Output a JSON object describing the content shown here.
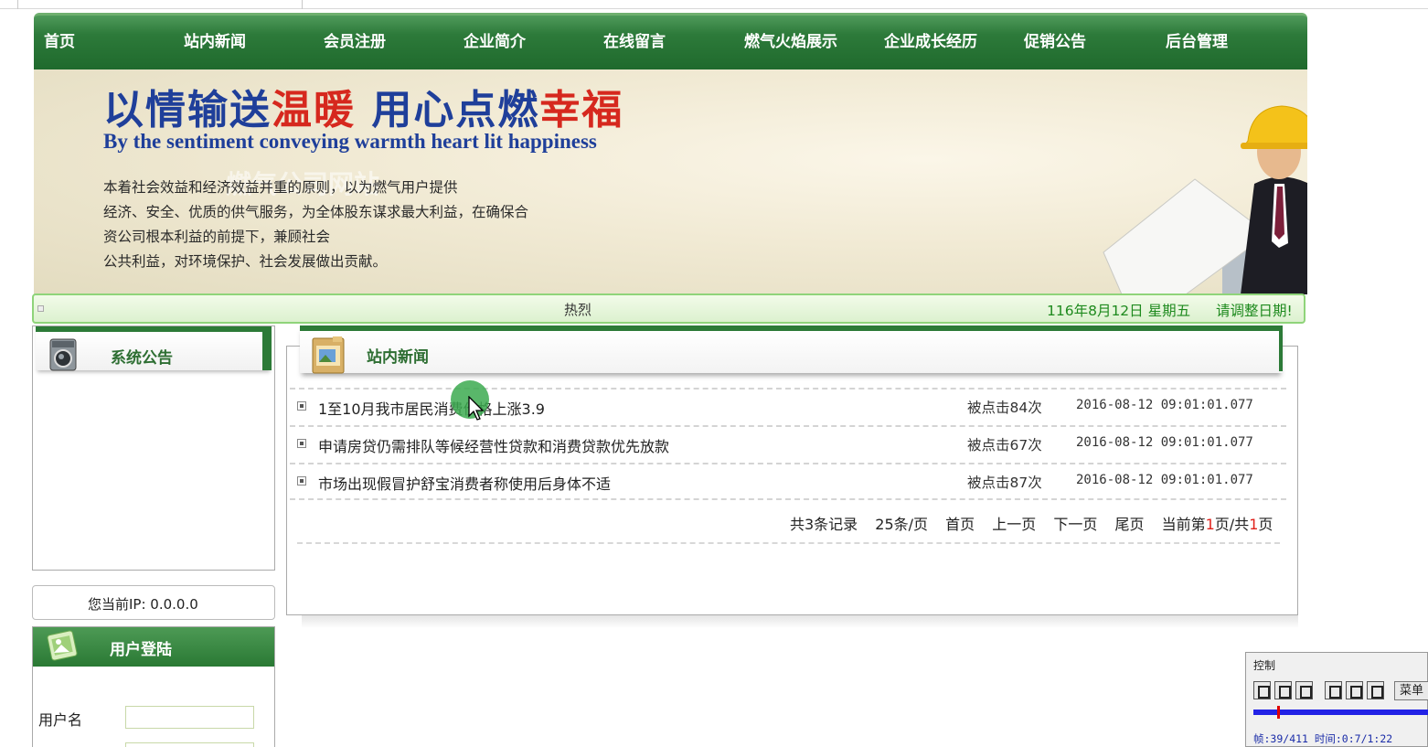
{
  "nav": {
    "items": [
      "首页",
      "站内新闻",
      "会员注册",
      "企业简介",
      "在线留言",
      "燃气火焰展示",
      "企业成长经历",
      "促销公告",
      "后台管理"
    ]
  },
  "banner": {
    "slogan_part1": "以情输送",
    "slogan_part2": "温暖",
    "slogan_part3": " 用心点燃",
    "slogan_part4": "幸福",
    "slogan_en": "By the sentiment conveying warmth heart lit happiness",
    "ghost_title": "燃气公司网站",
    "desc_lines": [
      "本着社会效益和经济效益并重的原则，以为燃气用户提供",
      "经济、安全、优质的供气服务，为全体股东谋求最大利益，在确保合",
      "资公司根本利益的前提下，兼顾社会",
      "公共利益，对环境保护、社会发展做出贡献。"
    ]
  },
  "infobar": {
    "marquee": "热烈",
    "date": "116年8月12日 星期五",
    "adjust": "请调整日期!"
  },
  "sidebar": {
    "notice_title": "系统公告",
    "ip_label": "您当前IP: 0.0.0.0",
    "login_title": "用户登陆",
    "username_label": "用户名"
  },
  "news": {
    "title": "站内新闻",
    "items": [
      {
        "title": "1至10月我市居民消费价格上涨3.9",
        "clicks": "被点击84次",
        "date": "2016-08-12 09:01:01.077"
      },
      {
        "title": "申请房贷仍需排队等候经营性贷款和消费贷款优先放款",
        "clicks": "被点击67次",
        "date": "2016-08-12 09:01:01.077"
      },
      {
        "title": "市场出现假冒护舒宝消费者称使用后身体不适",
        "clicks": "被点击87次",
        "date": "2016-08-12 09:01:01.077"
      }
    ],
    "pager": {
      "total": "共3条记录",
      "per_page": "25条/页",
      "first": "首页",
      "prev": "上一页",
      "next": "下一页",
      "last": "尾页",
      "current_prefix": "当前第",
      "current_page": "1",
      "current_mid": "页/共",
      "total_pages": "1",
      "current_suffix": "页"
    }
  },
  "control": {
    "title": "控制",
    "menu": "菜单",
    "frame_info": "帧:39/411 时间:0:7/1:22"
  },
  "colors": {
    "nav_green": "#2d7a3a",
    "slogan_blue": "#1f3f9a",
    "slogan_red": "#d6281e",
    "date_green": "#1e8a1e",
    "pager_red": "#e0201a"
  },
  "icons": {
    "notice": "washing-machine-icon",
    "news": "folder-photo-icon",
    "login": "picture-icon",
    "cursor": "mouse-pointer-icon"
  }
}
